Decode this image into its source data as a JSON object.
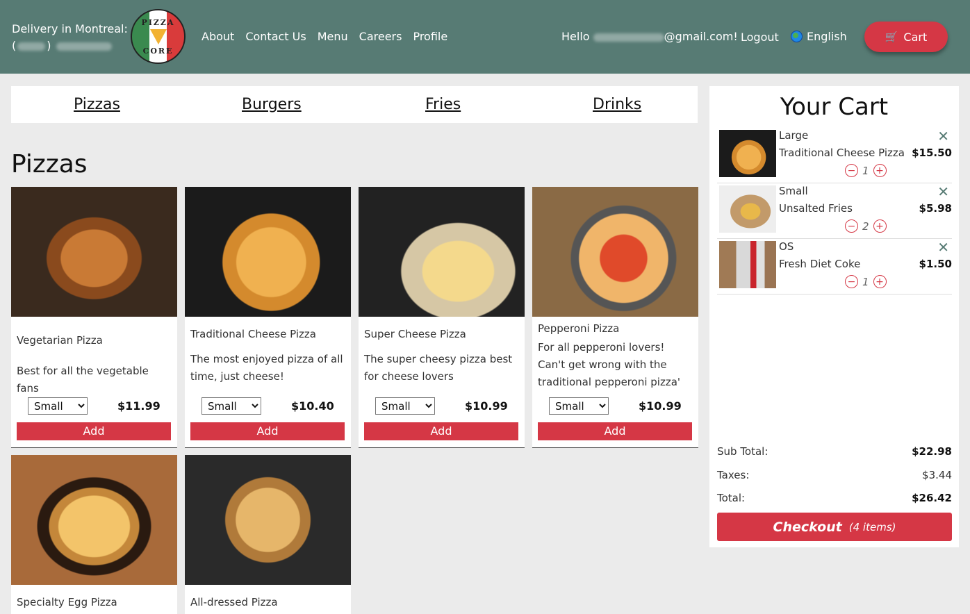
{
  "header": {
    "delivery_label": "Delivery in Montreal:",
    "phone_open": "(",
    "phone_close": ")",
    "logo_text_top": "PIZZA",
    "logo_text_bottom": "CORE",
    "nav": [
      "About",
      "Contact Us",
      "Menu",
      "Careers",
      "Profile"
    ],
    "hello": "Hello",
    "email_suffix": "@gmail.com!",
    "logout": "Logout",
    "language": "English",
    "cart_label": "Cart",
    "colors": {
      "bar": "#577b74",
      "accent": "#d53745"
    }
  },
  "categories": [
    "Pizzas",
    "Burgers",
    "Fries",
    "Drinks"
  ],
  "section_title": "Pizzas",
  "products": [
    {
      "name": "Vegetarian Pizza",
      "description": "Best for all the vegetable fans",
      "size": "Small",
      "price": "$11.99",
      "add": "Add"
    },
    {
      "name": "Traditional Cheese Pizza",
      "description": "The most enjoyed pizza of all time, just cheese!",
      "size": "Small",
      "price": "$10.40",
      "add": "Add"
    },
    {
      "name": "Super Cheese Pizza",
      "description": "The super cheesy pizza best for cheese lovers",
      "size": "Small",
      "price": "$10.99",
      "add": "Add"
    },
    {
      "name": "Pepperoni Pizza",
      "description": "For all pepperoni lovers! Can't get wrong with the traditional pepperoni pizza'",
      "size": "Small",
      "price": "$10.99",
      "add": "Add"
    },
    {
      "name": "Specialty Egg Pizza"
    },
    {
      "name": "All-dressed Pizza"
    }
  ],
  "cart": {
    "title": "Your Cart",
    "items": [
      {
        "size": "Large",
        "name": "Traditional Cheese Pizza",
        "price": "$15.50",
        "qty": "1"
      },
      {
        "size": "Small",
        "name": "Unsalted Fries",
        "price": "$5.98",
        "qty": "2"
      },
      {
        "size": "OS",
        "name": "Fresh Diet Coke",
        "price": "$1.50",
        "qty": "1"
      }
    ],
    "subtotal_label": "Sub Total:",
    "subtotal": "$22.98",
    "taxes_label": "Taxes:",
    "taxes": "$3.44",
    "total_label": "Total:",
    "total": "$26.42",
    "checkout_label": "Checkout",
    "checkout_count": "(4 items)"
  }
}
